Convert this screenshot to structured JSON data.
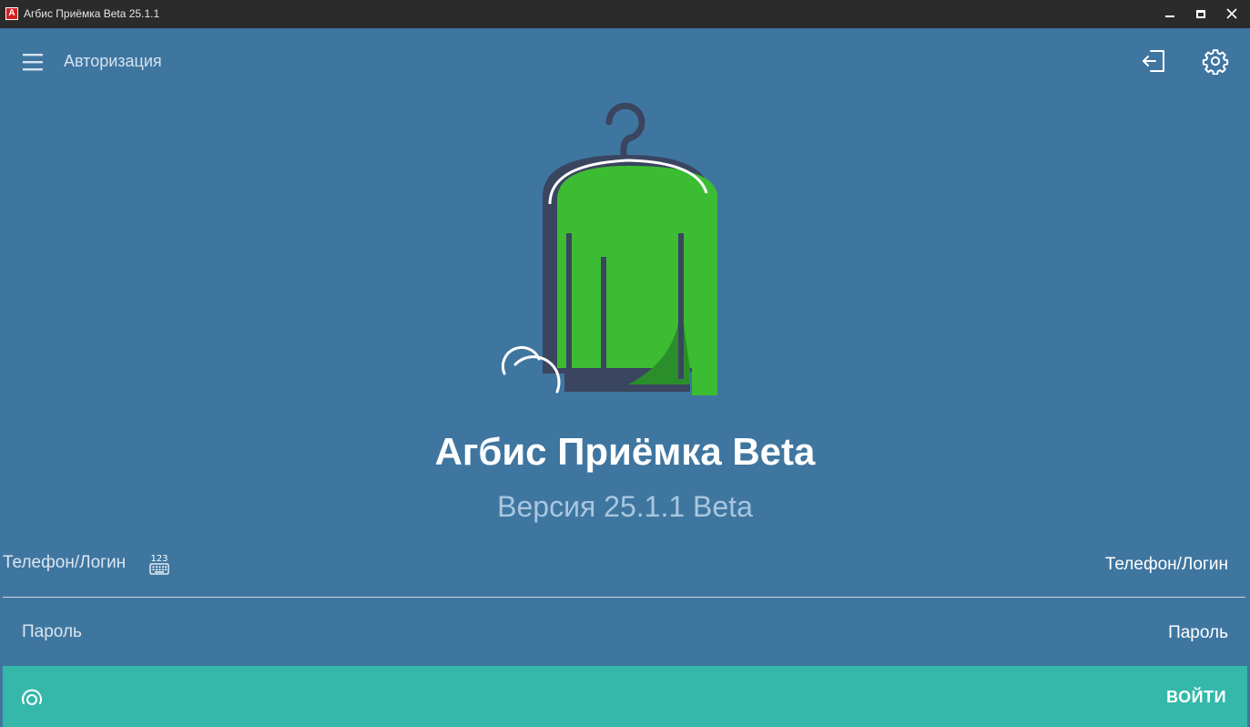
{
  "window": {
    "title": "Агбис Приёмка Beta 25.1.1",
    "app_icon_letter": "A",
    "controls": [
      "minimize-icon",
      "maximize-icon",
      "close-icon"
    ]
  },
  "header": {
    "title": "Авторизация",
    "icons": [
      "menu-icon",
      "exit-icon",
      "settings-icon"
    ]
  },
  "splash": {
    "app_name": "Агбис Приёмка Beta",
    "version": "Версия 25.1.1 Beta"
  },
  "form": {
    "login_label": "Телефон/Логин",
    "login_placeholder": "Телефон/Логин",
    "login_value": "",
    "keyboard_icon": "numeric-keyboard-icon",
    "keyboard_icon_text": "123",
    "password_label": "Пароль",
    "password_placeholder": "Пароль",
    "password_value": "",
    "submit_label": "ВОЙТИ",
    "fingerprint_icon": "fingerprint-icon"
  },
  "colors": {
    "background": "#3f76a0",
    "titlebar": "#2b2b2b",
    "accent_bar": "#35b8aa",
    "logo_green": "#3cbc32",
    "logo_dark": "#3a4560"
  }
}
